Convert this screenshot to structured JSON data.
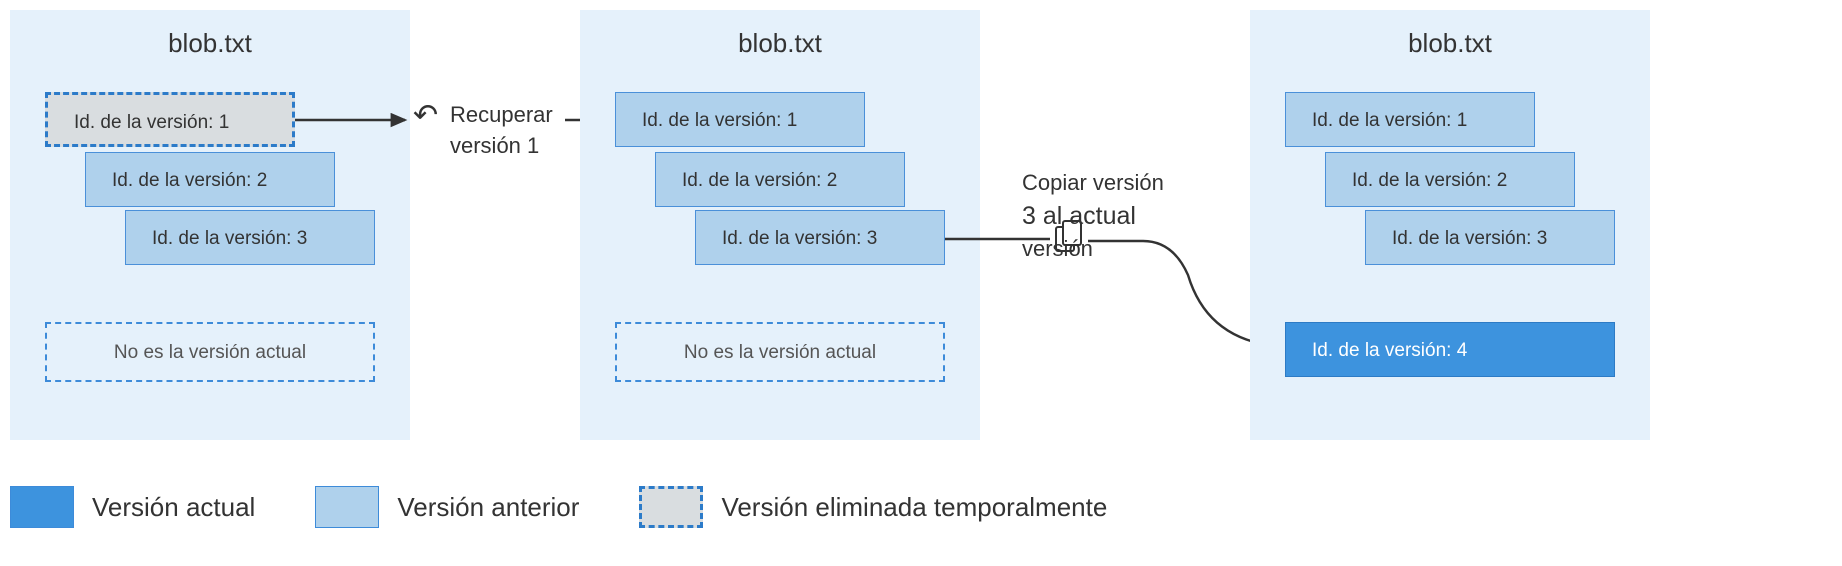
{
  "panel1": {
    "title": "blob.txt",
    "versions": [
      "Id. de la versión: 1",
      "Id. de la versión: 2",
      "Id. de la versión: 3"
    ],
    "noCurrent": "No es la versión actual"
  },
  "panel2": {
    "title": "blob.txt",
    "versions": [
      "Id. de la versión: 1",
      "Id. de la versión: 2",
      "Id. de la versión: 3"
    ],
    "noCurrent": "No es la versión actual"
  },
  "panel3": {
    "title": "blob.txt",
    "versions": [
      "Id. de la versión: 1",
      "Id. de la versión: 2",
      "Id. de la versión: 3",
      "Id. de la versión: 4"
    ]
  },
  "action1_line1": "Recuperar",
  "action1_line2": "versión 1",
  "action2_line1": "Copiar versión",
  "action2_line2": "3 al actual",
  "action2_line3": "versión",
  "legend": {
    "current": "Versión actual",
    "previous": "Versión anterior",
    "deleted": "Versión eliminada temporalmente"
  }
}
